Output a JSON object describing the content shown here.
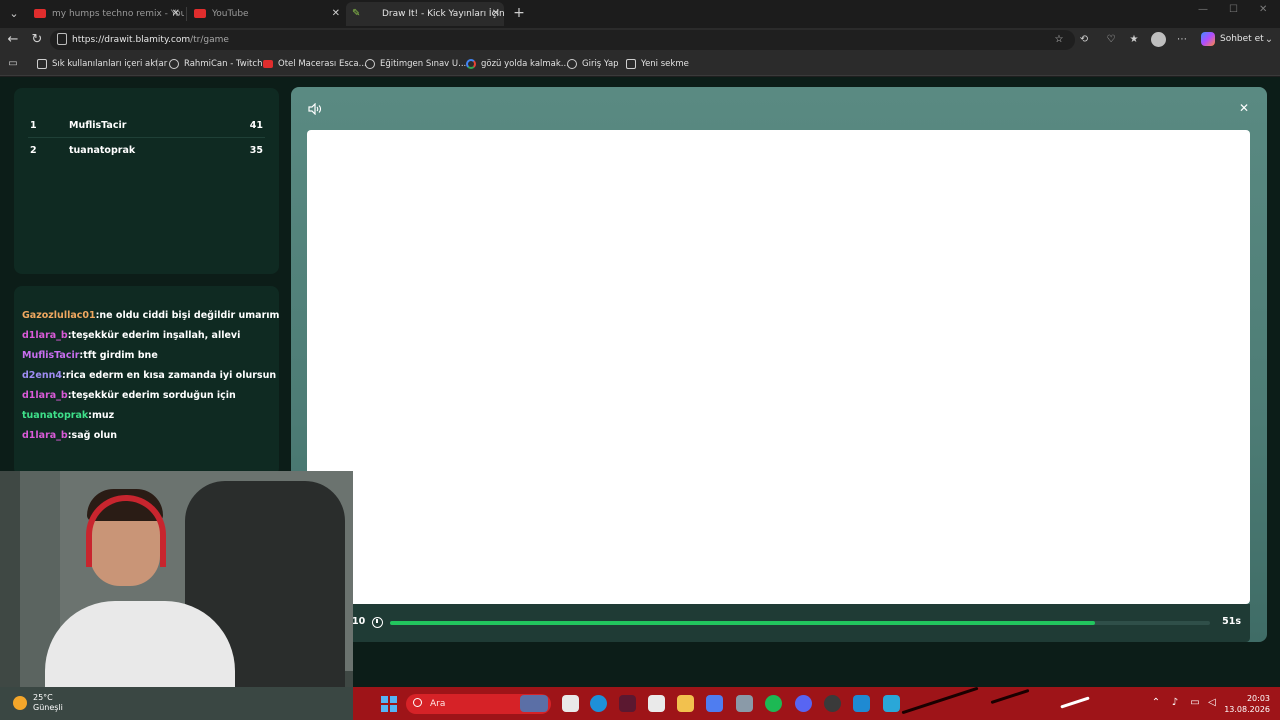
{
  "browser": {
    "tabs": [
      {
        "title": "my humps techno remix - YouTub",
        "active": false
      },
      {
        "title": "YouTube",
        "active": false
      },
      {
        "title": "Draw It! - Kick Yayınları İçin Ç",
        "active": true
      }
    ],
    "url_host": "https://drawit.blamity.com",
    "url_path": "/tr/game",
    "copilot_label": "Sohbet et",
    "bookmarks": [
      "Sık kullanılanları içeri aktar",
      "RahmiCan - Twitch",
      "Otel Macerası Esca...",
      "Eğitimgen Sınav U...",
      "gözü yolda kalmak...",
      "Giriş Yap",
      "Yeni sekme"
    ]
  },
  "leaderboard": [
    {
      "rank": "1",
      "name": "MuflisTacir",
      "score": "41"
    },
    {
      "rank": "2",
      "name": "tuanatoprak",
      "score": "35"
    }
  ],
  "chat": [
    {
      "user": "Gazozlullac01",
      "msg": "ne oldu ciddi bişi değildir umarım",
      "color": "#f0a860"
    },
    {
      "user": "d1lara_b",
      "msg": "teşekkür ederim inşallah, allevi",
      "color": "#d95bd8"
    },
    {
      "user": "MuflisTacir",
      "msg": "tft girdim bne",
      "color": "#c86ef0"
    },
    {
      "user": "d2enn4",
      "msg": "rica ederm en kısa zamanda iyi olursun",
      "color": "#9f8cf2"
    },
    {
      "user": "d1lara_b",
      "msg": "teşekkür ederim sorduğun için",
      "color": "#d95bd8"
    },
    {
      "user": "tuanatoprak",
      "msg": "muz",
      "color": "#3ee08a"
    },
    {
      "user": "d1lara_b",
      "msg": "sağ olun",
      "color": "#d95bd8"
    }
  ],
  "game": {
    "round_label": "10",
    "seconds_label": "51s",
    "timer_progress_percent": 86
  },
  "taskbar": {
    "temperature": "25°C",
    "weather": "Güneşli",
    "search_placeholder": "Ara",
    "time": "20:03",
    "date": "13.08.2026"
  },
  "colors": {
    "timer_fill": "#22c55e",
    "panel_bg": "#0f2a22",
    "game_panel": "#5a8a82"
  }
}
